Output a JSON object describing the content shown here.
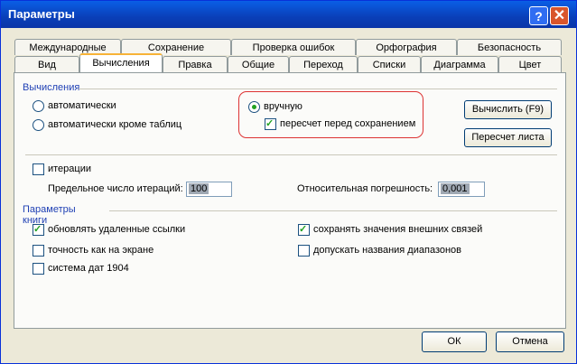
{
  "window": {
    "title": "Параметры",
    "help_label": "?",
    "close_label": "✕"
  },
  "tabs_row1": [
    "Международные",
    "Сохранение",
    "Проверка ошибок",
    "Орфография",
    "Безопасность"
  ],
  "tabs_row2": [
    "Вид",
    "Вычисления",
    "Правка",
    "Общие",
    "Переход",
    "Списки",
    "Диаграмма",
    "Цвет"
  ],
  "active_tab": "Вычисления",
  "calc": {
    "section": "Вычисления",
    "auto": "автоматически",
    "auto_except_tables": "автоматически кроме таблиц",
    "manual": "вручную",
    "recalc_before_save": "пересчет перед сохранением",
    "calc_button": "Вычислить (F9)",
    "recalc_sheet_button": "Пересчет листа"
  },
  "iter": {
    "label": "итерации",
    "max_label": "Предельное число итераций:",
    "max_value": "100",
    "err_label": "Относительная погрешность:",
    "err_value": "0,001"
  },
  "workbook": {
    "section": "Параметры книги",
    "update_links": "обновлять удаленные ссылки",
    "precision": "точность как на экране",
    "date_1904": "система дат 1904",
    "save_external": "сохранять значения внешних связей",
    "accept_labels": "допускать названия диапазонов"
  },
  "footer": {
    "ok": "ОК",
    "cancel": "Отмена"
  },
  "state": {
    "calc_mode": "manual",
    "recalc_before_save": true,
    "iterations": false,
    "update_links": true,
    "precision": false,
    "date_1904": false,
    "save_external": true,
    "accept_labels": false
  }
}
